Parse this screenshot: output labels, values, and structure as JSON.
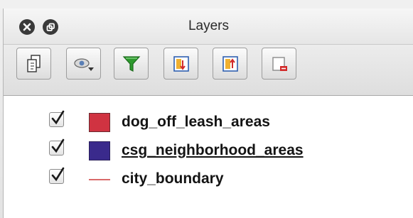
{
  "window": {
    "title": "Layers",
    "close_icon": "close-icon",
    "float_icon": "float-icon"
  },
  "toolbar": {
    "buttons": [
      {
        "name": "add-group-button",
        "icon": "add-group-icon"
      },
      {
        "name": "manage-visibility-button",
        "icon": "eye-dropdown-icon"
      },
      {
        "name": "filter-legend-button",
        "icon": "funnel-icon"
      },
      {
        "name": "expand-all-button",
        "icon": "expand-all-icon"
      },
      {
        "name": "collapse-all-button",
        "icon": "collapse-all-icon"
      },
      {
        "name": "remove-layer-button",
        "icon": "remove-layer-icon"
      }
    ]
  },
  "layers": [
    {
      "name": "dog_off_leash_areas",
      "checked": true,
      "symbol": "fill",
      "color": "#d03341",
      "border": "#6a2a30",
      "selected": false
    },
    {
      "name": "csg_neighborhood_areas",
      "checked": true,
      "symbol": "fill",
      "color": "#3a2a8c",
      "border": "#2a1f5a",
      "selected": true
    },
    {
      "name": "city_boundary",
      "checked": true,
      "symbol": "line",
      "color": "#d96a6a",
      "selected": false
    }
  ],
  "colors": {
    "funnel": "#2e9a2e",
    "expand_red": "#d22a2a",
    "toolbar_blue": "#2f5fb0"
  }
}
